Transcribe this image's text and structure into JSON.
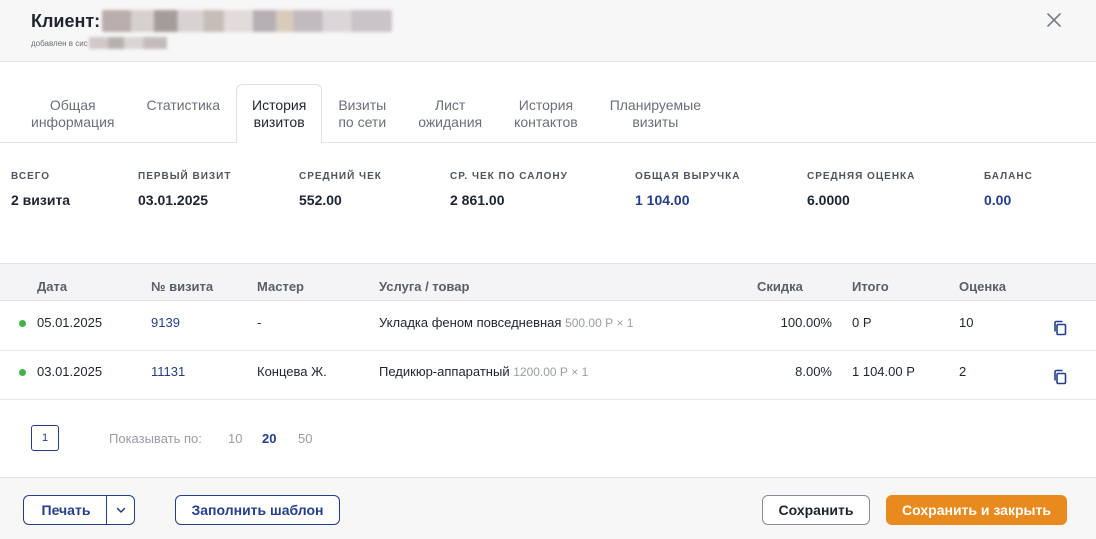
{
  "header": {
    "title_prefix": "Клиент:",
    "subtitle_prefix": "добавлен в сис"
  },
  "tabs": [
    {
      "label": "Общая\nинформация",
      "active": false
    },
    {
      "label": "Статистика",
      "active": false
    },
    {
      "label": "История\nвизитов",
      "active": true
    },
    {
      "label": "Визиты\nпо сети",
      "active": false
    },
    {
      "label": "Лист\nожидания",
      "active": false
    },
    {
      "label": "История\nконтактов",
      "active": false
    },
    {
      "label": "Планируемые\nвизиты",
      "active": false
    }
  ],
  "stats": [
    {
      "label": "ВСЕГО",
      "value": "2 визита",
      "color": "#1f2430"
    },
    {
      "label": "ПЕРВЫЙ ВИЗИТ",
      "value": "03.01.2025",
      "color": "#1f2430"
    },
    {
      "label": "СРЕДНИЙ ЧЕК",
      "value": "552.00",
      "color": "#1f2430"
    },
    {
      "label": "СР. ЧЕК ПО САЛОНУ",
      "value": "2 861.00",
      "color": "#1f2430"
    },
    {
      "label": "ОБЩАЯ ВЫРУЧКА",
      "value": "1 104.00",
      "color": "#233e8b"
    },
    {
      "label": "СРЕДНЯЯ ОЦЕНКА",
      "value": "6.0000",
      "color": "#1f2430"
    },
    {
      "label": "БАЛАНС",
      "value": "0.00",
      "color": "#233e8b"
    }
  ],
  "table": {
    "columns": [
      "Дата",
      "№ визита",
      "Мастер",
      "Услуга / товар",
      "Скидка",
      "Итого",
      "Оценка"
    ],
    "rows": [
      {
        "date": "05.01.2025",
        "visit": "9139",
        "master": "-",
        "service": "Укладка феном повседневная",
        "price": "500.00 Р × 1",
        "discount": "100.00%",
        "total": "0 Р",
        "rating": "10",
        "status_color": "#3fb449"
      },
      {
        "date": "03.01.2025",
        "visit": "11131",
        "master": "Концева Ж.",
        "service": "Педикюр-аппаратный",
        "price": "1200.00 Р × 1",
        "discount": "8.00%",
        "total": "1 104.00 Р",
        "rating": "2",
        "status_color": "#3fb449"
      }
    ]
  },
  "pagination": {
    "current_page": "1",
    "per_page_label": "Показывать по:",
    "per_page_options": [
      "10",
      "20",
      "50"
    ],
    "per_page_selected": "20"
  },
  "footer": {
    "print": "Печать",
    "fill_template": "Заполнить шаблон",
    "save": "Сохранить",
    "save_close": "Сохранить и закрыть"
  },
  "colors": {
    "accent": "#233e8b",
    "primary_button": "#e98a1e",
    "status_active": "#3fb449"
  }
}
